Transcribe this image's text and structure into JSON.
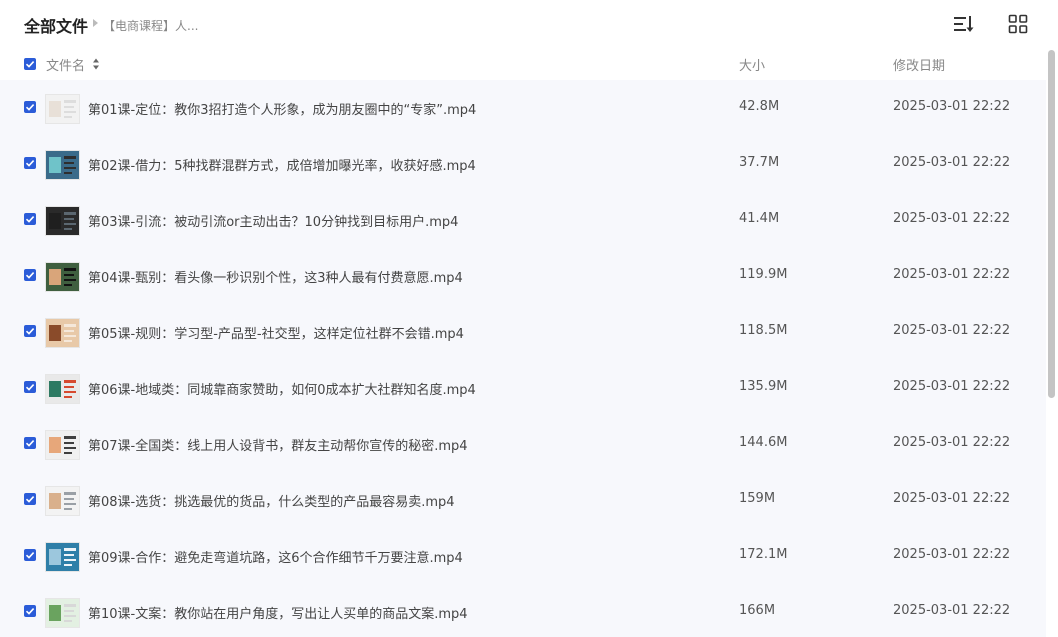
{
  "header": {
    "root_title": "全部文件",
    "breadcrumb": "【电商课程】人...",
    "sort_button_icon": "sort-icon",
    "view_button_icon": "grid-view-icon"
  },
  "columns": {
    "name": "文件名",
    "size": "大小",
    "date": "修改日期"
  },
  "colors": {
    "accent": "#2b5cd8",
    "row_bg": "#f7f8fc"
  },
  "files": [
    {
      "name": "第01课-定位：教你3招打造个人形象，成为朋友圈中的“专家”.mp4",
      "size": "42.8M",
      "date": "2025-03-01 22:22",
      "checked": true
    },
    {
      "name": "第02课-借力：5种找群混群方式，成倍增加曝光率，收获好感.mp4",
      "size": "37.7M",
      "date": "2025-03-01 22:22",
      "checked": true
    },
    {
      "name": "第03课-引流：被动引流or主动出击？10分钟找到目标用户.mp4",
      "size": "41.4M",
      "date": "2025-03-01 22:22",
      "checked": true
    },
    {
      "name": "第04课-甄别：看头像一秒识别个性，这3种人最有付费意愿.mp4",
      "size": "119.9M",
      "date": "2025-03-01 22:22",
      "checked": true
    },
    {
      "name": "第05课-规则：学习型-产品型-社交型，这样定位社群不会错.mp4",
      "size": "118.5M",
      "date": "2025-03-01 22:22",
      "checked": true
    },
    {
      "name": "第06课-地域类：同城靠商家赞助，如何0成本扩大社群知名度.mp4",
      "size": "135.9M",
      "date": "2025-03-01 22:22",
      "checked": true
    },
    {
      "name": "第07课-全国类：线上用人设背书，群友主动帮你宣传的秘密.mp4",
      "size": "144.6M",
      "date": "2025-03-01 22:22",
      "checked": true
    },
    {
      "name": "第08课-选货：挑选最优的货品，什么类型的产品最容易卖.mp4",
      "size": "159M",
      "date": "2025-03-01 22:22",
      "checked": true
    },
    {
      "name": "第09课-合作：避免走弯道坑路，这6个合作细节千万要注意.mp4",
      "size": "172.1M",
      "date": "2025-03-01 22:22",
      "checked": true
    },
    {
      "name": "第10课-文案：教你站在用户角度，写出让人买单的商品文案.mp4",
      "size": "166M",
      "date": "2025-03-01 22:22",
      "checked": true
    }
  ]
}
